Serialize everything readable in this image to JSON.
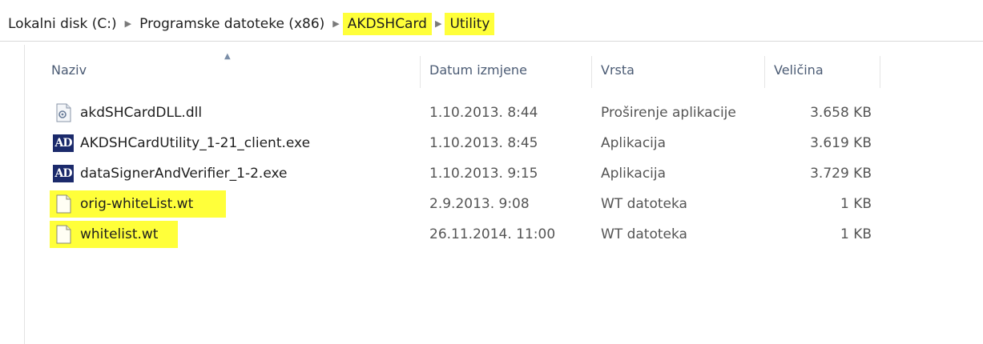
{
  "breadcrumb": [
    {
      "label": "Lokalni disk (C:)",
      "highlight": false
    },
    {
      "label": "Programske datoteke (x86)",
      "highlight": false
    },
    {
      "label": "AKDSHCard",
      "highlight": true
    },
    {
      "label": "Utility",
      "highlight": true
    }
  ],
  "columns": {
    "name": "Naziv",
    "date": "Datum izmjene",
    "type": "Vrsta",
    "size": "Veličina"
  },
  "files": [
    {
      "name": "akdSHCardDLL.dll",
      "date": "1.10.2013. 8:44",
      "type": "Proširenje aplikacije",
      "size": "3.658 KB",
      "icon": "dll-file-icon",
      "highlight": false
    },
    {
      "name": "AKDSHCardUtility_1-21_client.exe",
      "date": "1.10.2013. 8:45",
      "type": "Aplikacija",
      "size": "3.619 KB",
      "icon": "akd-app-icon",
      "highlight": false
    },
    {
      "name": "dataSignerAndVerifier_1-2.exe",
      "date": "1.10.2013. 9:15",
      "type": "Aplikacija",
      "size": "3.729 KB",
      "icon": "akd-app-icon",
      "highlight": false
    },
    {
      "name": "orig-whiteList.wt",
      "date": "2.9.2013. 9:08",
      "type": "WT datoteka",
      "size": "1 KB",
      "icon": "blank-file-icon",
      "highlight": true
    },
    {
      "name": "whitelist.wt",
      "date": "26.11.2014. 11:00",
      "type": "WT datoteka",
      "size": "1 KB",
      "icon": "blank-file-icon",
      "highlight": true
    }
  ],
  "colors": {
    "highlight": "#ffff3a",
    "header_text": "#4b5b74"
  }
}
